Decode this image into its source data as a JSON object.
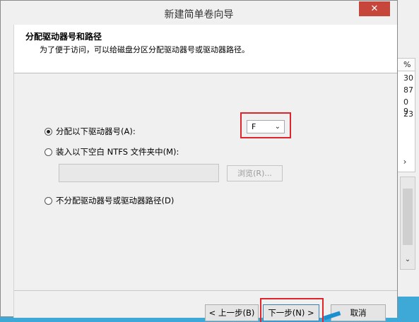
{
  "background_app": {
    "table_header": "%",
    "values": [
      "30",
      "87",
      "0 9",
      "23"
    ],
    "scroll_right_icon": "chevron-right-icon",
    "scroll_down_icon": "chevron-down-icon"
  },
  "dialog": {
    "title": "新建简单卷向导",
    "close_icon": "close-icon",
    "header_title": "分配驱动器号和路径",
    "header_subtitle": "为了便于访问，可以给磁盘分区分配驱动器号或驱动器路径。"
  },
  "options": {
    "assign_letter_label": "分配以下驱动器号(A):",
    "mount_folder_label": "装入以下空白 NTFS 文件夹中(M):",
    "no_assign_label": "不分配驱动器号或驱动器路径(D)",
    "selected": "assign_letter"
  },
  "drive_select": {
    "value": "F",
    "chevron_icon": "chevron-down-icon"
  },
  "folder_input": {
    "value": ""
  },
  "browse_button": {
    "label": "浏览(R)...",
    "enabled": false
  },
  "footer": {
    "back_label": "< 上一步(B)",
    "next_label": "下一步(N) >",
    "cancel_label": "取消"
  },
  "colors": {
    "highlight": "#e0242b",
    "close_bg": "#c7463c",
    "desktop": "#3ea9d6"
  }
}
